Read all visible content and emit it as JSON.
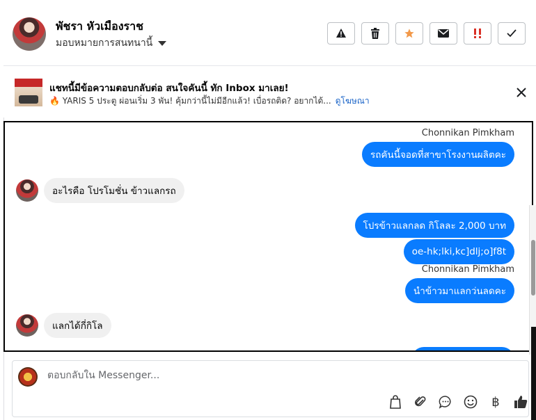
{
  "header": {
    "user_name": "พัชรา หัวเมืองราช",
    "assign_label": "มอบหมายการสนทนานี้",
    "actions": [
      {
        "icon": "warning-icon"
      },
      {
        "icon": "trash-icon"
      },
      {
        "icon": "star-icon",
        "color": "#f2994a"
      },
      {
        "icon": "mail-icon"
      },
      {
        "icon": "urgent-icon",
        "color": "#d93025"
      },
      {
        "icon": "check-icon"
      }
    ]
  },
  "ad": {
    "title": "แชทนี้มีข้อความตอบกลับต่อ สนใจคันนี้ ทัก Inbox มาเลย!",
    "subtitle": "🔥 YARIS 5 ประตู ผ่อนเริ่ม 3 พัน! คุ้มกว่านี้ไม่มีอีกแล้ว! เบื่อรถติด? อยากได้...",
    "link": "ดูโฆษณา"
  },
  "messages": [
    {
      "sender": "Chonnikan Pimkham"
    },
    {
      "text": "รถคันนี้จอดที่สาขาโรงงานผลิตคะ",
      "direction": "out"
    },
    {
      "text": "อะไรคือ โปรโมชั่น ข้าวแลกรถ",
      "direction": "in"
    },
    {
      "text": "โปรข้าวแลกลด กิโลละ 2,000 บาท",
      "direction": "out"
    },
    {
      "text": "oe-hk;lki,kc]dlj;o]f8t",
      "direction": "out"
    },
    {
      "sender": "Chonnikan Pimkham"
    },
    {
      "text": "นำข้าวมาแลกว่นลดคะ",
      "direction": "out"
    },
    {
      "text": "แลกได้กี่กิโล",
      "direction": "in"
    }
  ],
  "composer": {
    "placeholder": "ตอบกลับใน Messenger...",
    "tools": [
      "shopping-bag-icon",
      "paperclip-icon",
      "chat-bubble-icon",
      "emoji-icon",
      "baht-icon",
      "thumbs-up-icon"
    ],
    "baht_symbol": "฿"
  },
  "colors": {
    "accent": "#0a7cff",
    "incoming": "#f0f0f0",
    "link": "#1a64c8"
  }
}
